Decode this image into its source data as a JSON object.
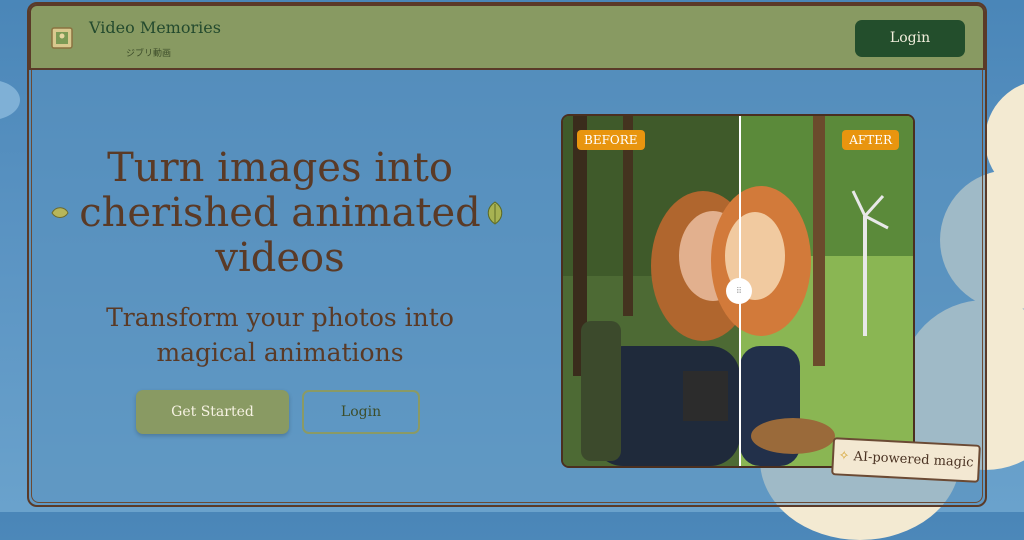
{
  "header": {
    "brand_title": "Video Memories",
    "brand_subtitle": "ジブリ動画",
    "login_label": "Login",
    "logo_icon": "framed-picture-icon"
  },
  "hero": {
    "title": "Turn images into cherished animated videos",
    "subtitle": "Transform your photos into magical animations",
    "primary_cta": "Get Started",
    "secondary_cta": "Login"
  },
  "comparison": {
    "before_label": "BEFORE",
    "after_label": "AFTER",
    "slider_handle": "drag-handle-icon",
    "badge_text": "AI-powered magic",
    "badge_icon": "sparkle-icon"
  },
  "colors": {
    "header_bg": "#889a62",
    "accent_dark_green": "#234e2c",
    "title_brown": "#5a3a26",
    "tag_orange": "#e8950f",
    "sky_blue": "#4a86b8"
  }
}
